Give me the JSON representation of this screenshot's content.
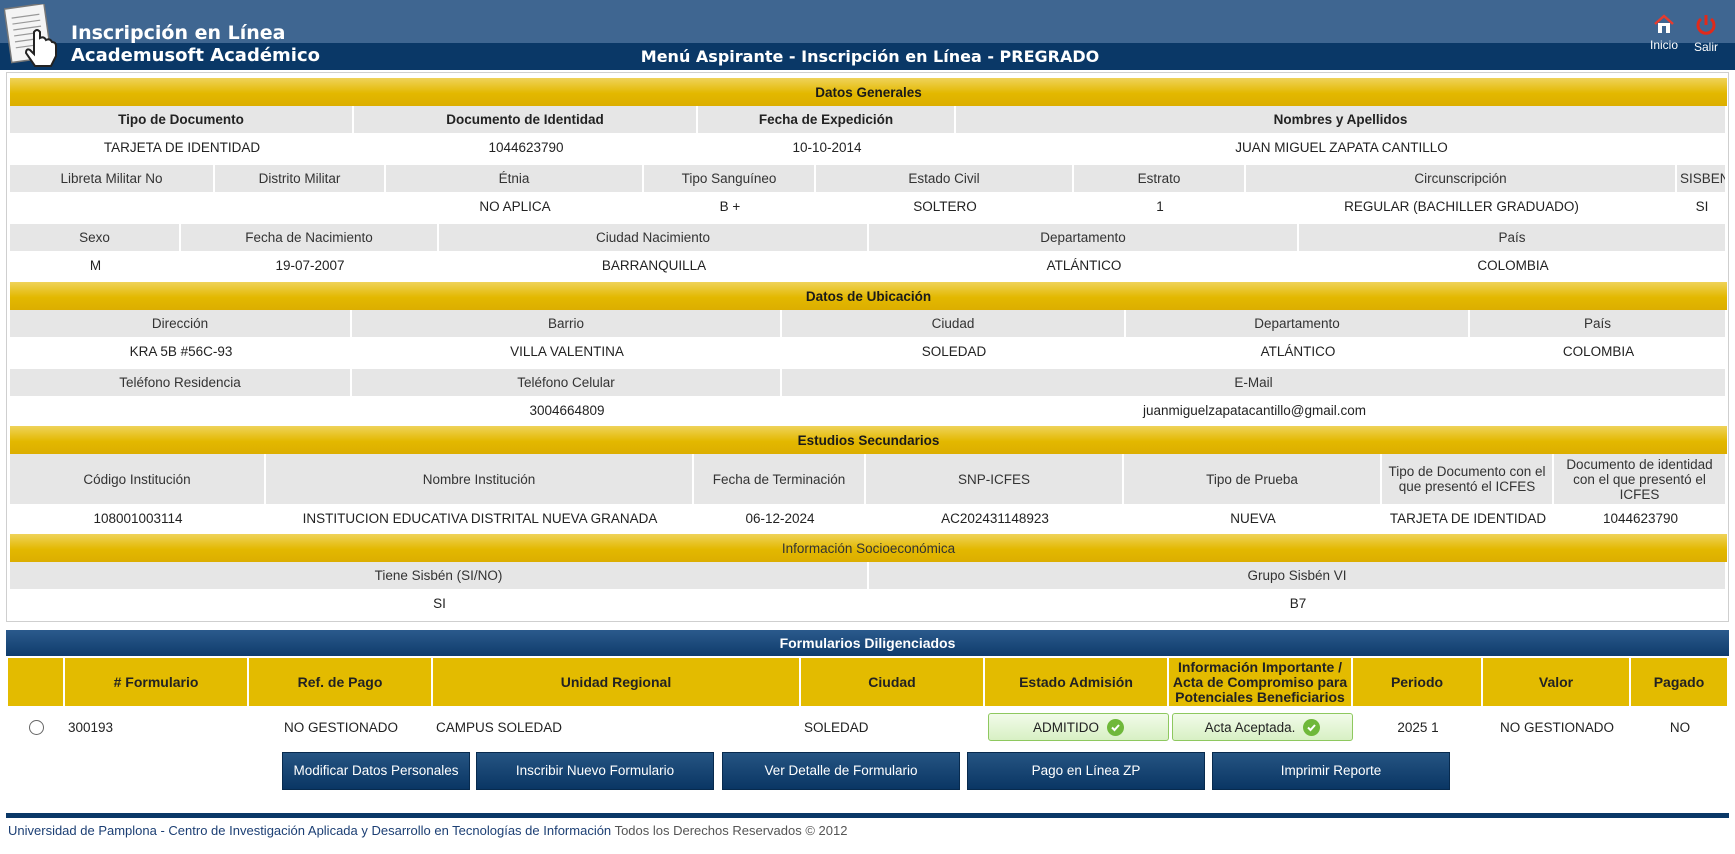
{
  "header": {
    "app_title": "Inscripción en Línea",
    "app_subtitle": "Academusoft Académico",
    "page_heading": "Menú Aspirante - Inscripción en Línea - PREGRADO",
    "home_label": "Inicio",
    "logout_label": "Salir",
    "icons": [
      "document-hand-icon",
      "home-icon",
      "power-icon"
    ]
  },
  "datos_generales": {
    "title": "Datos Generales",
    "row1_labels": [
      "Tipo de Documento",
      "Documento de Identidad",
      "Fecha de Expedición",
      "Nombres y Apellidos"
    ],
    "row1_values": [
      "TARJETA DE IDENTIDAD",
      "1044623790",
      "10-10-2014",
      "JUAN MIGUEL ZAPATA CANTILLO"
    ],
    "row2_labels": [
      "Libreta Militar No",
      "Distrito Militar",
      "Étnia",
      "Tipo Sanguíneo",
      "Estado Civil",
      "Estrato",
      "Circunscripción",
      "SISBEN"
    ],
    "row2_values": [
      "",
      "",
      "NO APLICA",
      "B +",
      "SOLTERO",
      "1",
      "REGULAR (BACHILLER GRADUADO)",
      "SI"
    ],
    "row3_labels": [
      "Sexo",
      "Fecha de Nacimiento",
      "Ciudad Nacimiento",
      "Departamento",
      "País"
    ],
    "row3_values": [
      "M",
      "19-07-2007",
      "BARRANQUILLA",
      "ATLÁNTICO",
      "COLOMBIA"
    ]
  },
  "ubicacion": {
    "title": "Datos de Ubicación",
    "row1_labels": [
      "Dirección",
      "Barrio",
      "Ciudad",
      "Departamento",
      "País"
    ],
    "row1_values": [
      "KRA 5B #56C-93",
      "VILLA VALENTINA",
      "SOLEDAD",
      "ATLÁNTICO",
      "COLOMBIA"
    ],
    "row2_labels": [
      "Teléfono Residencia",
      "Teléfono Celular",
      "E-Mail"
    ],
    "row2_values": [
      "",
      "3004664809",
      "juanmiguelzapatacantillo@gmail.com"
    ]
  },
  "estudios": {
    "title": "Estudios Secundarios",
    "labels": [
      "Código Institución",
      "Nombre Institución",
      "Fecha de Terminación",
      "SNP-ICFES",
      "Tipo de Prueba",
      "Tipo de Documento con el que presentó el ICFES",
      "Documento de identidad con el que presentó el ICFES"
    ],
    "values": [
      "108001003114",
      "INSTITUCION EDUCATIVA DISTRITAL NUEVA GRANADA",
      "06-12-2024",
      "AC202431148923",
      "NUEVA",
      "TARJETA DE IDENTIDAD",
      "1044623790"
    ]
  },
  "socioeconomica": {
    "title": "Información Socioeconómica",
    "labels": [
      "Tiene Sisbén (SI/NO)",
      "Grupo Sisbén VI"
    ],
    "values": [
      "SI",
      "B7"
    ]
  },
  "formularios": {
    "title": "Formularios Diligenciados",
    "columns": [
      "",
      "# Formulario",
      "Ref. de Pago",
      "Unidad Regional",
      "Ciudad",
      "Estado Admisión",
      "Información Importante / Acta de Compromiso para Potenciales Beneficiarios",
      "Periodo",
      "Valor",
      "Pagado"
    ],
    "rows": [
      {
        "formulario": "300193",
        "ref_pago": "NO GESTIONADO",
        "unidad": "CAMPUS SOLEDAD",
        "ciudad": "SOLEDAD",
        "estado": "ADMITIDO",
        "acta": "Acta Aceptada.",
        "periodo": "2025 1",
        "valor": "NO GESTIONADO",
        "pagado": "NO"
      }
    ],
    "status_color": "#6fb83a"
  },
  "actions": {
    "modificar": "Modificar Datos Personales",
    "inscribir": "Inscribir Nuevo Formulario",
    "detalle": "Ver Detalle de Formulario",
    "pago": "Pago en Línea ZP",
    "imprimir": "Imprimir Reporte"
  },
  "footer": {
    "link": "Universidad de Pamplona - Centro de Investigación Aplicada y Desarrollo en Tecnologías de Información",
    "rights": "Todos los Derechos Reservados © 2012"
  },
  "colors": {
    "header_top": "#3f6691",
    "header_bottom": "#0a3867",
    "section_gold": "#e3b800",
    "label_gray": "#e6e6e6"
  }
}
